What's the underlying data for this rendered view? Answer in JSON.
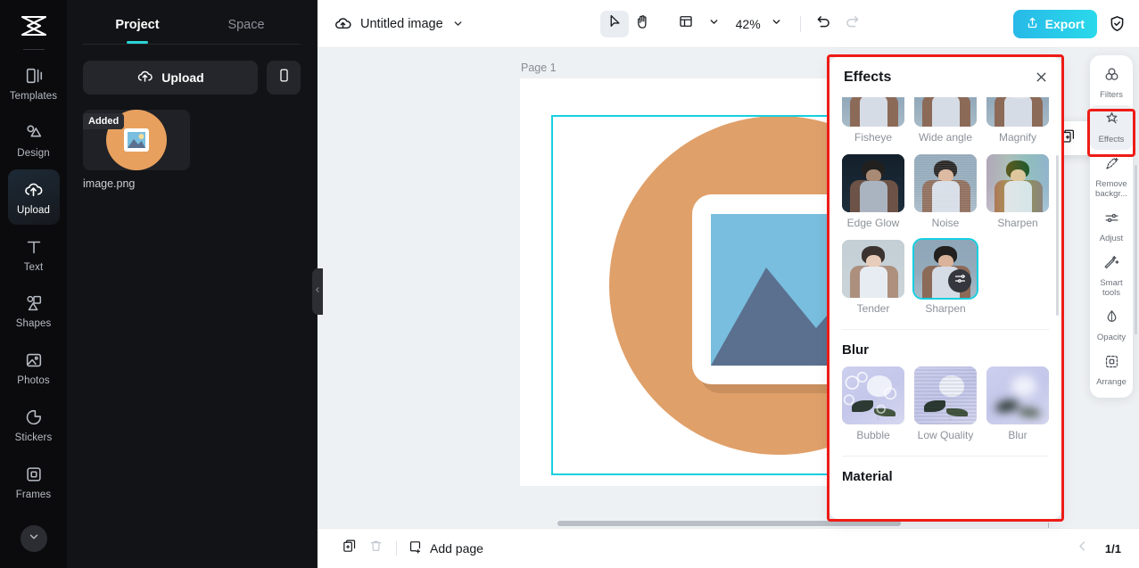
{
  "left_rail": {
    "logo": "capcut-logo-icon",
    "items": [
      {
        "label": "Templates",
        "icon": "templates-icon",
        "active": false
      },
      {
        "label": "Design",
        "icon": "design-icon",
        "active": false
      },
      {
        "label": "Upload",
        "icon": "upload-cloud-icon",
        "active": true
      },
      {
        "label": "Text",
        "icon": "text-icon",
        "active": false
      },
      {
        "label": "Shapes",
        "icon": "shapes-icon",
        "active": false
      },
      {
        "label": "Photos",
        "icon": "photos-icon",
        "active": false
      },
      {
        "label": "Stickers",
        "icon": "stickers-icon",
        "active": false
      },
      {
        "label": "Frames",
        "icon": "frames-icon",
        "active": false
      },
      {
        "label": "",
        "icon": "grid-layout-icon",
        "active": false
      }
    ],
    "more_icon": "chevron-down-icon"
  },
  "panel": {
    "tabs": [
      {
        "label": "Project",
        "active": true
      },
      {
        "label": "Space",
        "active": false
      }
    ],
    "upload_label": "Upload",
    "upload_icon": "upload-cloud-icon",
    "mobile_icon": "mobile-phone-icon",
    "asset": {
      "badge": "Added",
      "name": "image.png",
      "thumb_icon": "image-placeholder-icon"
    },
    "collapse_icon": "chevron-left-icon"
  },
  "topbar": {
    "cloud_icon": "cloud-save-icon",
    "doc_title": "Untitled image",
    "title_caret": "chevron-down-icon",
    "tools": [
      {
        "name": "select-tool",
        "icon": "cursor-arrow-icon",
        "selected": true
      },
      {
        "name": "hand-tool",
        "icon": "hand-icon",
        "selected": false
      }
    ],
    "layout_icon": "layout-icon",
    "layout_caret": "chevron-down-icon",
    "zoom_value": "42%",
    "zoom_caret": "chevron-down-icon",
    "undo_icon": "undo-icon",
    "redo_icon": "redo-icon",
    "export_label": "Export",
    "export_icon": "share-up-icon",
    "export_color": "#2ad0e8",
    "shield_icon": "shield-check-icon"
  },
  "canvas": {
    "page_label": "Page 1",
    "accent_color": "#16cfe0",
    "object_toolbar": [
      {
        "name": "crop-button",
        "icon": "crop-icon"
      },
      {
        "name": "cutout-button",
        "icon": "cutout-icon"
      },
      {
        "name": "duplicate-button",
        "icon": "duplicate-icon"
      },
      {
        "name": "more-button",
        "icon": "more-horizontal-icon"
      }
    ],
    "rotate_icon": "rotate-icon",
    "artwork": {
      "circle_color": "#e0a06a",
      "card_color": "#ffffff",
      "sky_color": "#79bede",
      "sun_color": "#f6dc98",
      "mountain_color": "#5b708f"
    }
  },
  "effects_panel": {
    "title": "Effects",
    "close_icon": "close-icon",
    "highlight_color": "#ee1b16",
    "selected_effect": "Sharpen",
    "adjust_icon": "sliders-icon",
    "groups": [
      {
        "name": "",
        "items": [
          {
            "label": "Fisheye",
            "kind": "portrait",
            "selected": false
          },
          {
            "label": "Wide angle",
            "kind": "portrait",
            "selected": false
          },
          {
            "label": "Magnify",
            "kind": "portrait",
            "selected": false
          },
          {
            "label": "Edge Glow",
            "kind": "portrait",
            "selected": false
          },
          {
            "label": "Noise",
            "kind": "portrait",
            "selected": false
          },
          {
            "label": "Sharpen",
            "kind": "portrait",
            "selected": false
          },
          {
            "label": "Tender",
            "kind": "portrait",
            "selected": false
          },
          {
            "label": "Sharpen",
            "kind": "portrait",
            "selected": true
          }
        ]
      },
      {
        "name": "Blur",
        "items": [
          {
            "label": "Bubble",
            "kind": "rose",
            "selected": false
          },
          {
            "label": "Low Quality",
            "kind": "rose",
            "selected": false
          },
          {
            "label": "Blur",
            "kind": "rose",
            "selected": false
          }
        ]
      },
      {
        "name": "Material",
        "items": []
      }
    ]
  },
  "tool_rail": {
    "items": [
      {
        "label": "Filters",
        "icon": "filters-icon",
        "selected": false
      },
      {
        "label": "Effects",
        "icon": "effects-sparkle-icon",
        "selected": true
      },
      {
        "label": "Remove backgr...",
        "icon": "remove-background-icon",
        "selected": false
      },
      {
        "label": "Adjust",
        "icon": "adjust-sliders-icon",
        "selected": false
      },
      {
        "label": "Smart tools",
        "icon": "magic-wand-icon",
        "selected": false
      },
      {
        "label": "Opacity",
        "icon": "opacity-drop-icon",
        "selected": false
      },
      {
        "label": "Arrange",
        "icon": "arrange-icon",
        "selected": false
      }
    ]
  },
  "bottombar": {
    "duplicate_icon": "duplicate-page-icon",
    "delete_icon": "trash-icon",
    "add_page_label": "Add page",
    "add_page_icon": "add-page-icon",
    "prev_icon": "chevron-left-icon",
    "page_indicator": "1/1"
  }
}
